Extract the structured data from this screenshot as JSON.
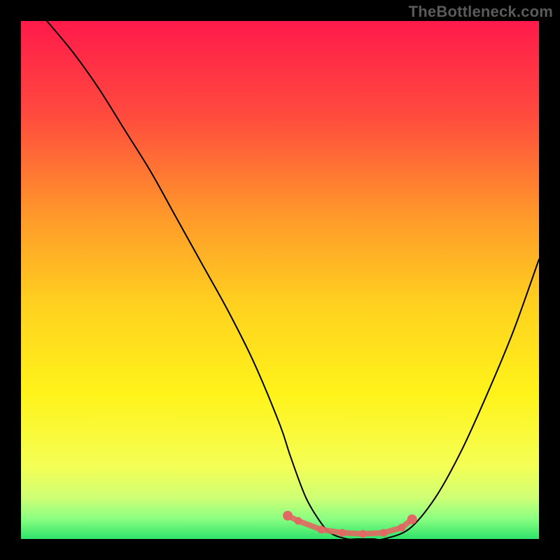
{
  "watermark": "TheBottleneck.com",
  "chart_data": {
    "type": "line",
    "title": "",
    "xlabel": "",
    "ylabel": "",
    "xlim": [
      0,
      100
    ],
    "ylim": [
      0,
      100
    ],
    "series": [
      {
        "name": "bottleneck-curve",
        "x": [
          5,
          10,
          15,
          20,
          25,
          30,
          35,
          40,
          45,
          50,
          52,
          55,
          58,
          60,
          63,
          65,
          68,
          70,
          75,
          80,
          85,
          90,
          95,
          100
        ],
        "y": [
          100,
          94,
          87,
          79,
          71,
          62,
          53,
          44,
          34,
          22,
          16,
          8,
          3,
          1,
          0,
          0,
          0,
          0,
          2,
          8,
          17,
          28,
          40,
          54
        ]
      },
      {
        "name": "optimal-marker-dots",
        "x": [
          51.5,
          53.5,
          58,
          62,
          66,
          70,
          73.5,
          75.5
        ],
        "y": [
          4.5,
          3.5,
          1.8,
          1.2,
          1.0,
          1.2,
          2.2,
          3.8
        ]
      }
    ],
    "gradient_stops": [
      {
        "pct": 0,
        "color": "#ff1a4b"
      },
      {
        "pct": 18,
        "color": "#ff4a3e"
      },
      {
        "pct": 38,
        "color": "#ff9a2a"
      },
      {
        "pct": 55,
        "color": "#ffd21f"
      },
      {
        "pct": 72,
        "color": "#fff31a"
      },
      {
        "pct": 86,
        "color": "#f4ff55"
      },
      {
        "pct": 92,
        "color": "#cfff74"
      },
      {
        "pct": 96,
        "color": "#8cff82"
      },
      {
        "pct": 100,
        "color": "#2fe36b"
      }
    ],
    "curve_color": "#000000",
    "marker_color": "#e06a63"
  }
}
